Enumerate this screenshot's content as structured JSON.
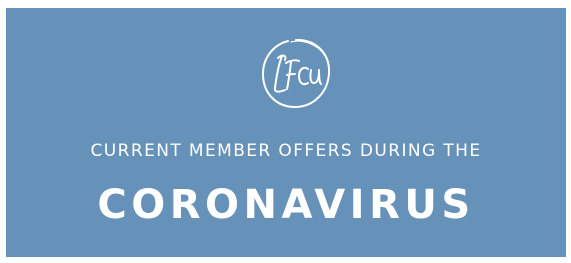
{
  "banner": {
    "background_color": "#6691b8",
    "text_color": "#ffffff",
    "logo": {
      "text": "LFCU",
      "icon": "lfcu-logo-icon"
    },
    "subtitle": "CURRENT MEMBER OFFERS DURING THE",
    "headline": "CORONAVIRUS"
  }
}
